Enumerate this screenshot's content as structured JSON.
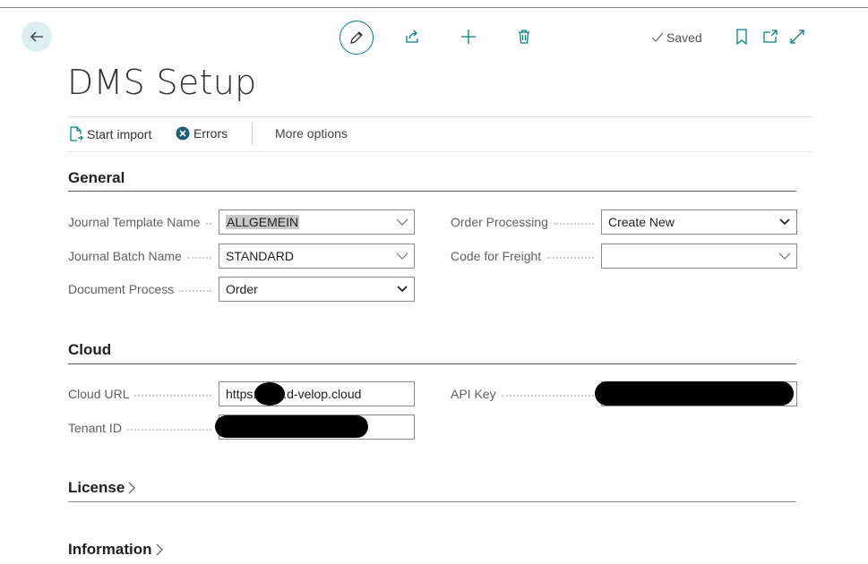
{
  "header": {
    "title": "DMS Setup",
    "saved_label": "Saved",
    "icons": [
      "back-arrow-icon",
      "pencil-icon",
      "share-icon",
      "plus-icon",
      "trash-icon",
      "checkmark-icon",
      "bookmark-icon",
      "open-new-window-icon",
      "expand-icon"
    ]
  },
  "actions": {
    "start_import": "Start import",
    "errors": "Errors",
    "more_options": "More options"
  },
  "general": {
    "title": "General",
    "journal_template_name": {
      "label": "Journal Template Name",
      "value": "ALLGEMEIN"
    },
    "journal_batch_name": {
      "label": "Journal Batch Name",
      "value": "STANDARD"
    },
    "document_process": {
      "label": "Document Process",
      "value": "Order"
    },
    "order_processing": {
      "label": "Order Processing",
      "value": "Create New"
    },
    "code_for_freight": {
      "label": "Code for Freight",
      "value": ""
    }
  },
  "cloud": {
    "title": "Cloud",
    "cloud_url": {
      "label": "Cloud URL",
      "value_prefix": "https:",
      "value_suffix": ".d-velop.cloud"
    },
    "tenant_id": {
      "label": "Tenant ID",
      "value": ""
    },
    "api_key": {
      "label": "API Key",
      "value": ""
    }
  },
  "license": {
    "title": "License"
  },
  "information": {
    "title": "Information"
  },
  "colors": {
    "accent": "#00807f",
    "back_bg": "#dcefef",
    "errors_icon": "#1b5e7a"
  }
}
